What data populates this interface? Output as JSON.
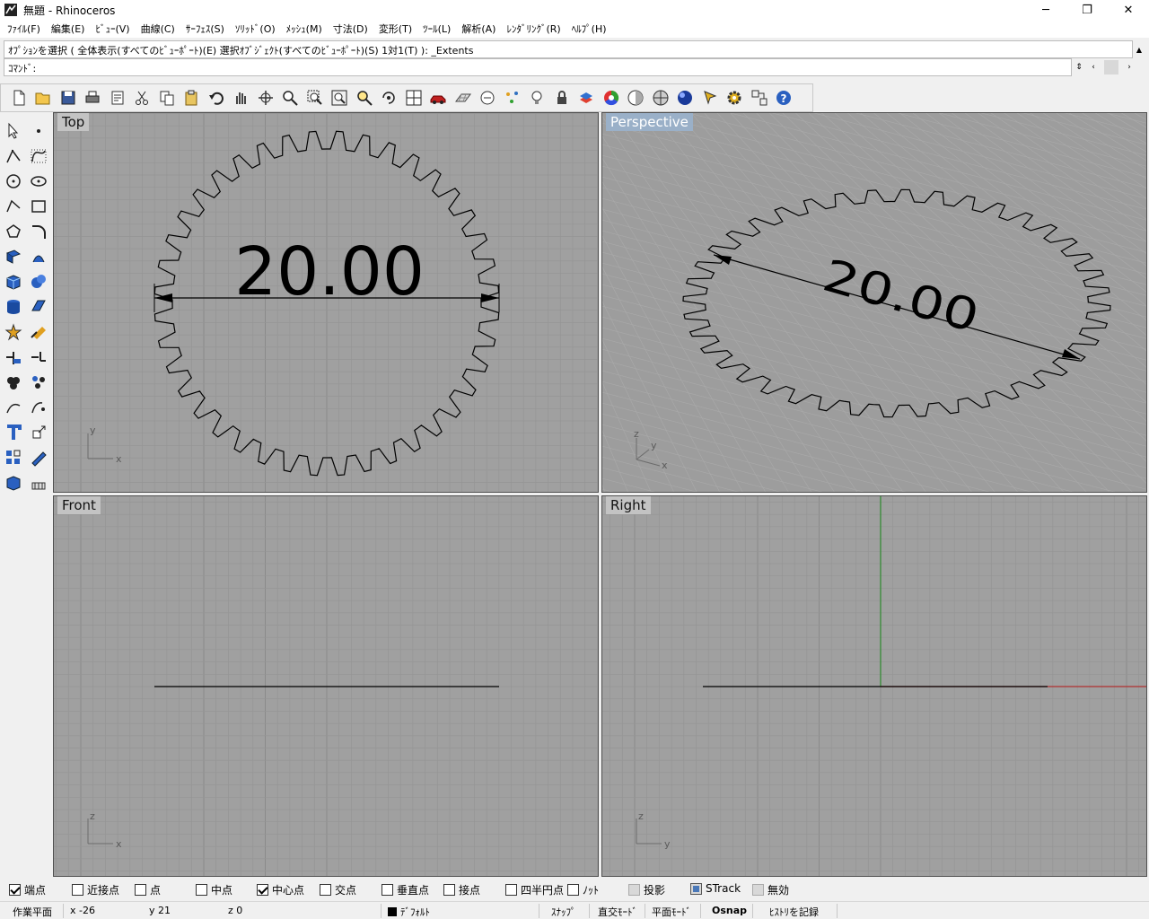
{
  "window": {
    "title": "無題 - Rhinoceros",
    "controls": {
      "minimize": "─",
      "restore": "❐",
      "close": "✕"
    }
  },
  "menu": [
    "ﾌｧｲﾙ(F)",
    "編集(E)",
    "ﾋﾞｭｰ(V)",
    "曲線(C)",
    "ｻｰﾌｪｽ(S)",
    "ｿﾘｯﾄﾞ(O)",
    "ﾒｯｼｭ(M)",
    "寸法(D)",
    "変形(T)",
    "ﾂｰﾙ(L)",
    "解析(A)",
    "ﾚﾝﾀﾞﾘﾝｸﾞ(R)",
    "ﾍﾙﾌﾟ(H)"
  ],
  "command": {
    "history": "ｵﾌﾟｼｮﾝを選択 ( 全体表示(すべてのﾋﾞｭｰﾎﾟｰﾄ)(E)  選択ｵﾌﾞｼﾞｪｸﾄ(すべてのﾋﾞｭｰﾎﾟｰﾄ)(S)  1対1(T) ): _Extents",
    "prompt": "ｺﾏﾝﾄﾞ:"
  },
  "toolbar_icons": [
    "new-icon",
    "open-icon",
    "save-icon",
    "print-icon",
    "properties-icon",
    "cut-icon",
    "copy-icon",
    "paste-icon",
    "undo-icon",
    "pan-icon",
    "rotate-view-icon",
    "zoom-icon",
    "zoom-window-icon",
    "zoom-extents-icon",
    "zoom-selected-icon",
    "undo-view-icon",
    "four-viewports-icon",
    "car-icon",
    "grid-plane-icon",
    "osnap-icon",
    "points-icon",
    "light-icon",
    "lock-icon",
    "layer-icon",
    "color-wheel-icon",
    "shade-icon",
    "render-preview-icon",
    "render-sphere-icon",
    "pointer-icon",
    "gear-icon",
    "options-icon",
    "help-icon"
  ],
  "left_tools": [
    "select-icon",
    "point-icon",
    "polyline-icon",
    "curve-icon",
    "circle-icon",
    "ellipse-icon",
    "arc-icon",
    "rectangle-icon",
    "polygon-icon",
    "fillet-icon",
    "surface-icon",
    "surface-edge-icon",
    "box-icon",
    "sphere-icon",
    "cylinder-icon",
    "surface-tool-icon",
    "explode-icon",
    "boolean-icon",
    "trim-icon",
    "split-icon",
    "group-icon",
    "points-cloud-icon",
    "curve-from-object-icon",
    "curve-tools-icon",
    "text-icon",
    "transform-icon",
    "array-icon",
    "dimension-icon",
    "mesh-icon",
    "block-icon"
  ],
  "viewports": {
    "top": {
      "label": "Top",
      "dimension": "20.00",
      "axis_x": "x",
      "axis_y": "y"
    },
    "perspective": {
      "label": "Perspective",
      "dimension": "20.00",
      "axis_x": "x",
      "axis_y": "y",
      "axis_z": "z"
    },
    "front": {
      "label": "Front",
      "axis_x": "x",
      "axis_z": "z"
    },
    "right": {
      "label": "Right",
      "axis_y": "y",
      "axis_z": "z"
    }
  },
  "osnap": [
    {
      "label": "端点",
      "state": "checked"
    },
    {
      "label": "近接点",
      "state": "unchecked"
    },
    {
      "label": "点",
      "state": "unchecked"
    },
    {
      "label": "中点",
      "state": "unchecked"
    },
    {
      "label": "中心点",
      "state": "checked"
    },
    {
      "label": "交点",
      "state": "unchecked"
    },
    {
      "label": "垂直点",
      "state": "unchecked"
    },
    {
      "label": "接点",
      "state": "unchecked"
    },
    {
      "label": "四半円点",
      "state": "unchecked"
    },
    {
      "label": "ﾉｯﾄ",
      "state": "unchecked"
    },
    {
      "label": "投影",
      "state": "grey"
    },
    {
      "label": "STrack",
      "state": "blue"
    },
    {
      "label": "無効",
      "state": "grey"
    }
  ],
  "status": {
    "cplane": "作業平面",
    "x": "x -26",
    "y": "y 21",
    "z": "z 0",
    "layer": "ﾃﾞﾌｫﾙﾄ",
    "snap": "ｽﾅｯﾌﾟ",
    "ortho": "直交ﾓｰﾄﾞ",
    "planar": "平面ﾓｰﾄﾞ",
    "osnap": "Osnap",
    "history": "ﾋｽﾄﾘを記録"
  }
}
